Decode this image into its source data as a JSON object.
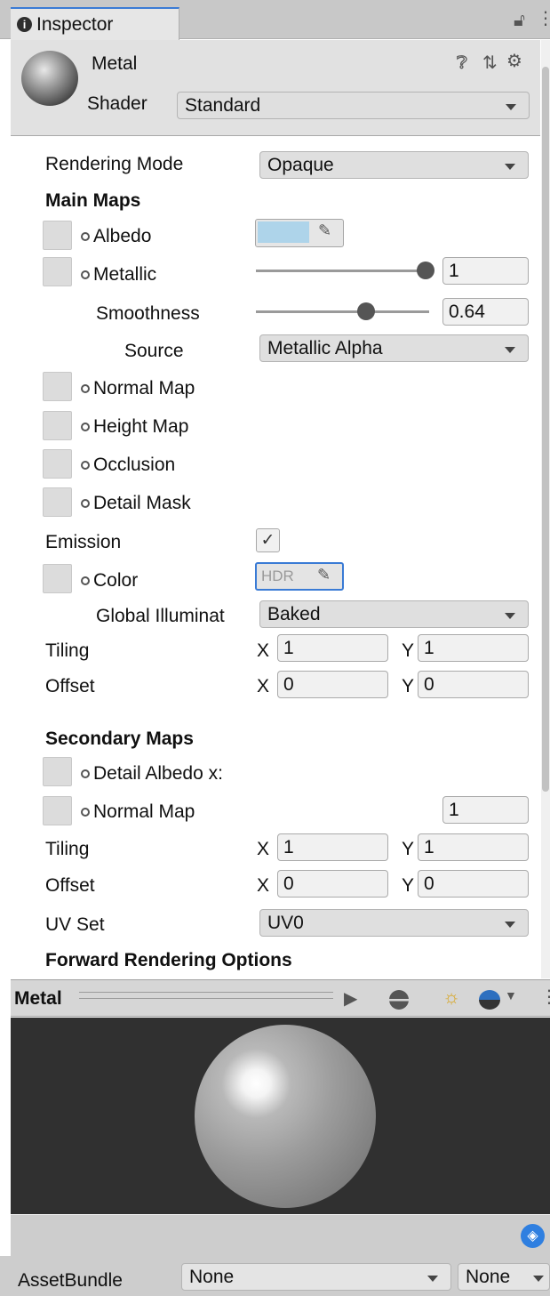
{
  "tab": {
    "title": "Inspector"
  },
  "header": {
    "material_name": "Metal",
    "shader_label": "Shader",
    "shader_value": "Standard"
  },
  "properties": {
    "rendering_mode": {
      "label": "Rendering Mode",
      "value": "Opaque"
    },
    "main_maps": "Main Maps",
    "albedo": "Albedo",
    "metallic": {
      "label": "Metallic",
      "value": "1",
      "slider_fraction": 1.0
    },
    "smoothness": {
      "label": "Smoothness",
      "value": "0.64",
      "slider_fraction": 0.64
    },
    "source": {
      "label": "Source",
      "value": "Metallic Alpha"
    },
    "normal_map": "Normal Map",
    "height_map": "Height Map",
    "occlusion": "Occlusion",
    "detail_mask": "Detail Mask",
    "emission": {
      "label": "Emission",
      "checked": true
    },
    "color": {
      "label": "Color",
      "hdr": "HDR"
    },
    "global_illumination": {
      "label": "Global Illuminat",
      "value": "Baked"
    },
    "tiling": {
      "label": "Tiling",
      "x_label": "X",
      "x": "1",
      "y_label": "Y",
      "y": "1"
    },
    "offset": {
      "label": "Offset",
      "x_label": "X",
      "x": "0",
      "y_label": "Y",
      "y": "0"
    },
    "secondary_maps": "Secondary Maps",
    "detail_albedo": "Detail Albedo x:",
    "secondary_normal_map": {
      "label": "Normal Map",
      "value": "1"
    },
    "secondary_tiling": {
      "label": "Tiling",
      "x_label": "X",
      "x": "1",
      "y_label": "Y",
      "y": "1"
    },
    "secondary_offset": {
      "label": "Offset",
      "x_label": "X",
      "x": "0",
      "y_label": "Y",
      "y": "0"
    },
    "uv_set": {
      "label": "UV Set",
      "value": "UV0"
    },
    "forward_rendering": "Forward Rendering Options"
  },
  "preview": {
    "title": "Metal"
  },
  "assetbundle": {
    "label": "AssetBundle",
    "value": "None",
    "variant": "None"
  },
  "colors": {
    "albedo": "#aed4ea",
    "preview_bg": "#303030",
    "accent": "#3a7bd5"
  }
}
